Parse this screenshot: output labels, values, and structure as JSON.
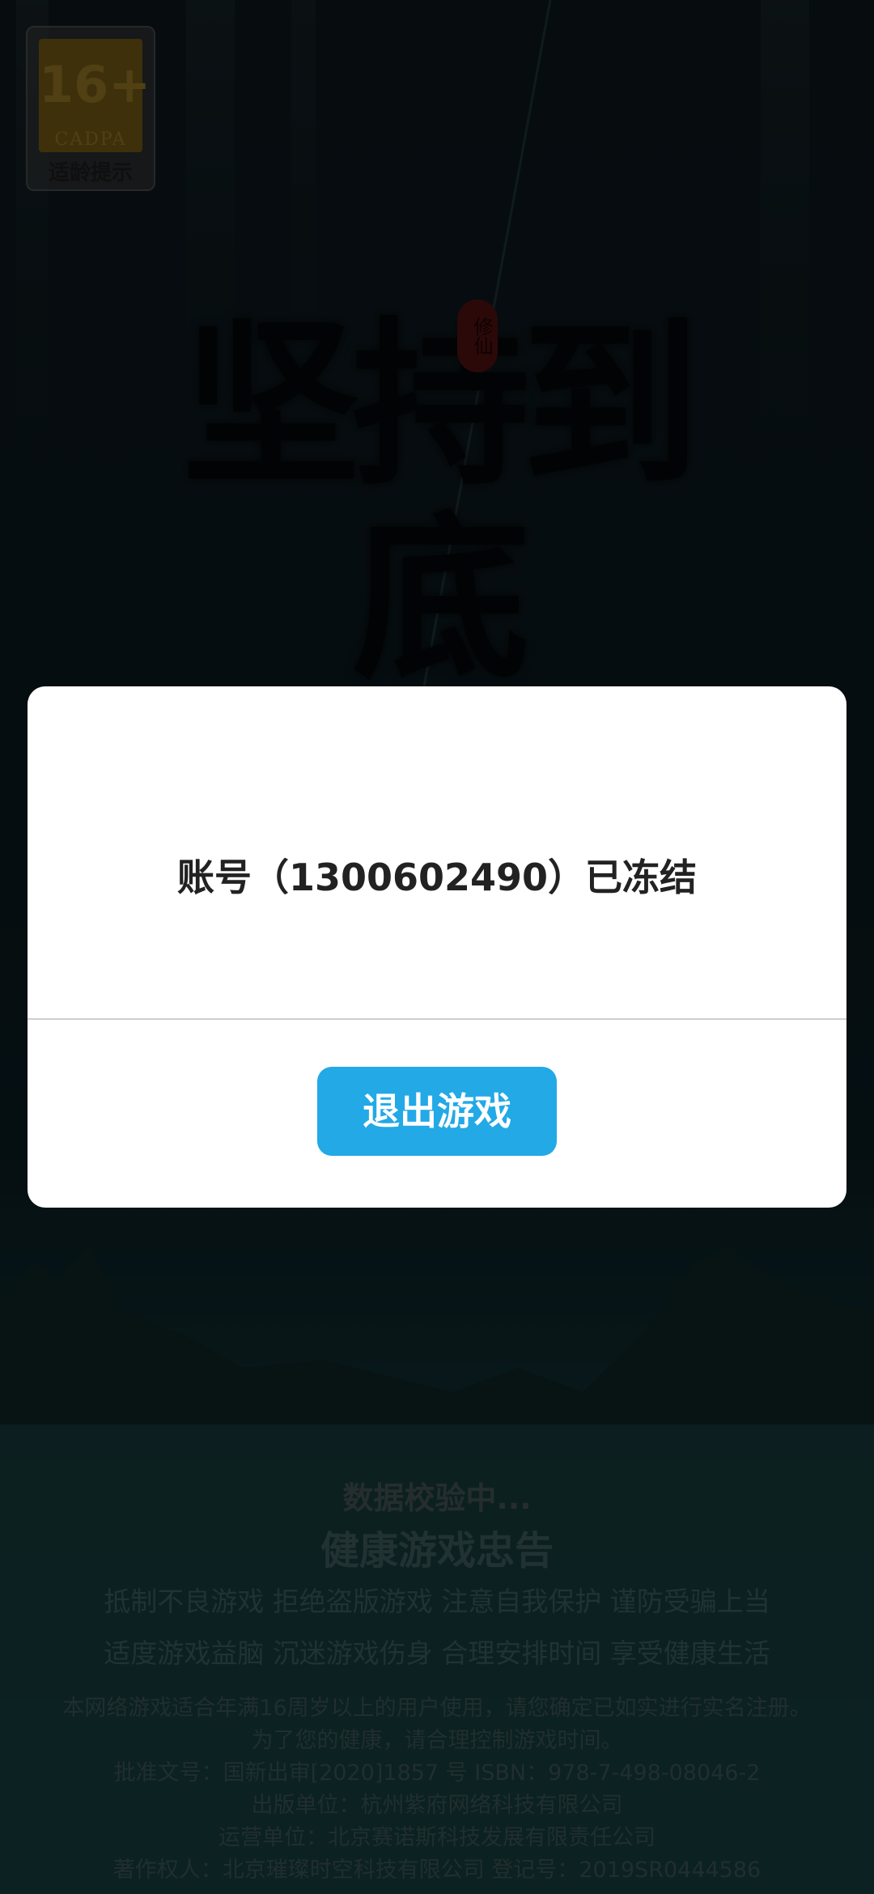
{
  "age_rating": {
    "number": "16+",
    "org": "CADPA",
    "caption": "适龄提示"
  },
  "game_logo": {
    "title": "坚持到底",
    "seal_text": "修仙"
  },
  "dialog": {
    "message": "账号（1300602490）已冻结",
    "exit_button_label": "退出游戏"
  },
  "footer": {
    "loading_text": "数据校验中...",
    "advisory_title": "健康游戏忠告",
    "advisory_line_1": "抵制不良游戏  拒绝盗版游戏  注意自我保护  谨防受骗上当",
    "advisory_line_2": "适度游戏益脑  沉迷游戏伤身  合理安排时间  享受健康生活",
    "notice_line_1": "本网络游戏适合年满16周岁以上的用户使用，请您确定已如实进行实名注册。",
    "notice_line_2": "为了您的健康，请合理控制游戏时间。",
    "approval_line": "批准文号：国新出审[2020]1857 号   ISBN：978-7-498-08046-2",
    "publisher_line": "出版单位：杭州紫府网络科技有限公司",
    "operator_line": "运营单位：北京赛诺斯科技发展有限责任公司",
    "copyright_line": "著作权人：北京璀璨时空科技有限公司  登记号：2019SR0444586"
  },
  "colors": {
    "button": "#22a9e6",
    "dialog_bg": "#ffffff",
    "message_text": "#222222"
  }
}
